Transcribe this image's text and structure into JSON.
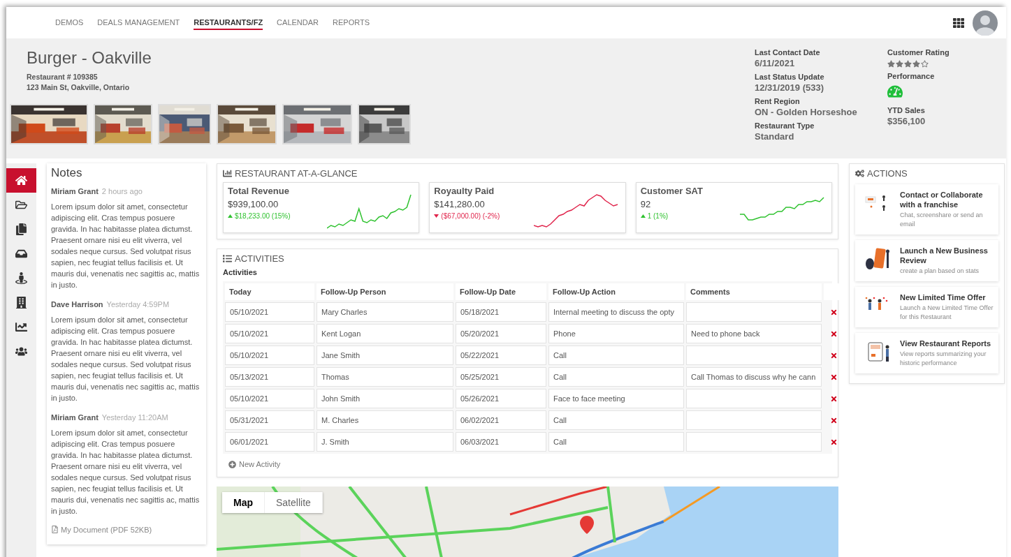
{
  "nav": {
    "items": [
      {
        "label": "DEMOS",
        "selected": false
      },
      {
        "label": "DEALS MANAGEMENT",
        "selected": false
      },
      {
        "label": "RESTAURANTS/FZ",
        "selected": true
      },
      {
        "label": "CALENDAR",
        "selected": false
      },
      {
        "label": "REPORTS",
        "selected": false
      }
    ]
  },
  "restaurant": {
    "name": "Burger  - Oakville",
    "number": "Restaurant # 109385",
    "address": "123 Main St, Oakville, Ontario"
  },
  "info": {
    "left": [
      {
        "label": "Last Contact Date",
        "value": "6/11/2021"
      },
      {
        "label": "Last Status Update",
        "value": "12/31/2019 (533)"
      },
      {
        "label": "Rent Region",
        "value": "ON - Golden Horseshoe"
      },
      {
        "label": "Restaurant Type",
        "value": "Standard"
      }
    ],
    "right": [
      {
        "label": "Customer Rating",
        "kind": "stars",
        "stars": 4
      },
      {
        "label": "Performance",
        "kind": "gauge"
      },
      {
        "label": "YTD Sales",
        "kind": "text",
        "value": "$356,100"
      }
    ]
  },
  "sidebar": {
    "items": [
      {
        "selected": true
      },
      {
        "selected": false
      },
      {
        "selected": false
      },
      {
        "selected": false
      },
      {
        "selected": false
      },
      {
        "selected": false
      },
      {
        "selected": false
      },
      {
        "selected": false
      }
    ]
  },
  "notes": {
    "title": "Notes",
    "entries": [
      {
        "author": "Miriam Grant",
        "time": "2 hours ago",
        "text": "Lorem ipsum dolor sit amet, consectetur adipiscing elit. Cras tempus posuere gravida. In hac habitasse platea dictumst. Praesent ornare nisi eu elit viverra, vel sodales neque cursus. Sed volutpat risus sapien, nec feugiat tellus facilisis et. Ut mauris dui, venenatis nec sagittis ac, mattis in justo."
      },
      {
        "author": "Dave Harrison",
        "time": "Yesterday 4:59PM",
        "text": "Lorem ipsum dolor sit amet, consectetur adipiscing elit. Cras tempus posuere gravida. In hac habitasse platea dictumst. Praesent ornare nisi eu elit viverra, vel sodales neque cursus. Sed volutpat risus sapien, nec feugiat tellus facilisis et. Ut mauris dui, venenatis nec sagittis ac, mattis in justo."
      },
      {
        "author": "Miriam Grant",
        "time": "Yesterday 11:20AM",
        "text": "Lorem ipsum dolor sit amet, consectetur adipiscing elit. Cras tempus posuere gravida. In hac habitasse platea dictumst. Praesent ornare nisi eu elit viverra, vel sodales neque cursus. Sed volutpat risus sapien, nec feugiat tellus facilisis et. Ut mauris dui, venenatis nec sagittis ac, mattis in justo."
      }
    ],
    "attachment": "My Document (PDF 52KB)"
  },
  "glance": {
    "title": "RESTAURANT AT-A-GLANCE",
    "cards": [
      {
        "title": "Total Revenue",
        "value": "$939,100.00",
        "change": "$18,233.00 (15%)",
        "kind": "up"
      },
      {
        "title": "Royaulty Paid",
        "value": "$141,280.00",
        "change": "($67,000.00) (-2%)",
        "kind": "down"
      },
      {
        "title": "Customer SAT",
        "value": "92",
        "change": "1 (1%)",
        "kind": "up"
      }
    ]
  },
  "activities": {
    "title": "ACTIVITIES",
    "subtitle": "Activities",
    "columns": [
      "Today",
      "Follow-Up Person",
      "Follow-Up Date",
      "Follow-Up Action",
      "Comments"
    ],
    "rows": [
      {
        "cells": [
          "05/10/2021",
          "Mary Charles",
          "05/18/2021",
          "Internal meeting to discuss the opty"
        ]
      },
      {
        "cells": [
          "05/10/2021",
          "Kent Logan",
          "05/20/2021",
          "Phone",
          "Need to phone back"
        ]
      },
      {
        "cells": [
          "05/10/2021",
          "Jane Smith",
          "05/22/2021",
          "Call"
        ]
      },
      {
        "cells": [
          "05/13/2021",
          "Thomas",
          "05/25/2021",
          "Call",
          "Call Thomas to discuss why he cann"
        ]
      },
      {
        "cells": [
          "05/10/2021",
          "John Smith",
          "05/26/2021",
          "Face to face meeting"
        ]
      },
      {
        "cells": [
          "05/31/2021",
          "M. Charles",
          "06/02/2021",
          "Call"
        ]
      },
      {
        "cells": [
          "06/01/2021",
          "J. Smith",
          "06/03/2021",
          "Call"
        ]
      }
    ],
    "add_label": "New Activity"
  },
  "map": {
    "tabs": [
      {
        "label": "Map",
        "selected": true
      },
      {
        "label": "Satellite",
        "selected": false
      }
    ]
  },
  "actions": {
    "title": "ACTIONS",
    "items": [
      {
        "title": "Contact or Collaborate with a franchise",
        "description": "Chat, screenshare or send an email"
      },
      {
        "title": "Launch a New Business Review",
        "description": "create a plan based on stats"
      },
      {
        "title": "New Limited Time Offer",
        "description": "Launch a New Limited Time Offer for this Restaurant"
      },
      {
        "title": "View Restaurant Reports",
        "description": "View reports summarizing your historic performance"
      }
    ]
  }
}
